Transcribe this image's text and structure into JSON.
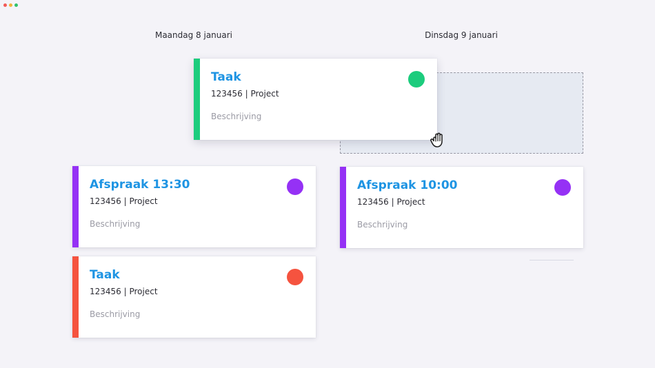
{
  "window": {
    "dots": [
      {
        "name": "close-dot",
        "color": "#f35a57"
      },
      {
        "name": "minimize-dot",
        "color": "#f1b33a"
      },
      {
        "name": "maximize-dot",
        "color": "#30c26b"
      }
    ]
  },
  "days": [
    {
      "label": "Maandag 8 januari"
    },
    {
      "label": "Dinsdag 9 januari"
    }
  ],
  "cards": {
    "dragged": {
      "title": "Taak",
      "meta": "123456 | Project",
      "description": "Beschrijving",
      "color": "#1ccc7d"
    },
    "monday_appointment": {
      "title": "Afspraak 13:30",
      "meta": "123456 | Project",
      "description": "Beschrijving",
      "color": "#9531f5"
    },
    "monday_task": {
      "title": "Taak",
      "meta": "123456 | Project",
      "description": "Beschrijving",
      "color": "#f5533f"
    },
    "tuesday_appointment": {
      "title": "Afspraak 10:00",
      "meta": "123456 | Project",
      "description": "Beschrijving",
      "color": "#9531f5"
    }
  },
  "cursor": {
    "icon": "grab-hand-icon"
  },
  "colors": {
    "title": "#1e94e3",
    "drop_zone": "#e6eaf2"
  }
}
